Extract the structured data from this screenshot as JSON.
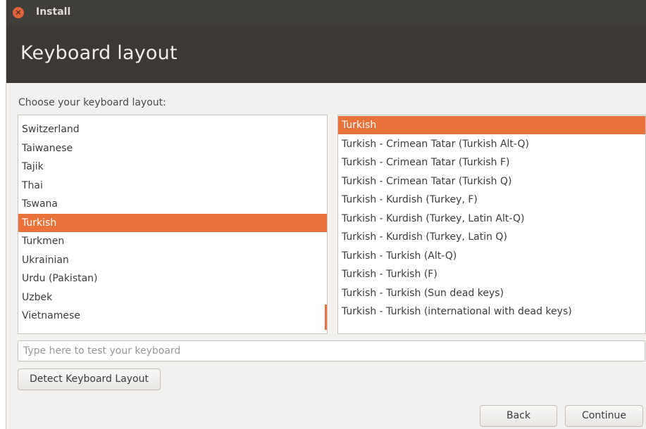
{
  "window": {
    "title": "Install"
  },
  "header": {
    "title": "Keyboard layout"
  },
  "prompt": "Choose your keyboard layout:",
  "layouts": {
    "items": [
      "Switzerland",
      "Taiwanese",
      "Tajik",
      "Thai",
      "Tswana",
      "Turkish",
      "Turkmen",
      "Ukrainian",
      "Urdu (Pakistan)",
      "Uzbek",
      "Vietnamese"
    ],
    "selected": "Turkish"
  },
  "variants": {
    "items": [
      "Turkish",
      "Turkish - Crimean Tatar (Turkish Alt-Q)",
      "Turkish - Crimean Tatar (Turkish F)",
      "Turkish - Crimean Tatar (Turkish Q)",
      "Turkish - Kurdish (Turkey, F)",
      "Turkish - Kurdish (Turkey, Latin Alt-Q)",
      "Turkish - Kurdish (Turkey, Latin Q)",
      "Turkish - Turkish (Alt-Q)",
      "Turkish - Turkish (F)",
      "Turkish - Turkish (Sun dead keys)",
      "Turkish - Turkish (international with dead keys)"
    ],
    "selected": "Turkish"
  },
  "test_input": {
    "placeholder": "Type here to test your keyboard",
    "value": ""
  },
  "buttons": {
    "detect": "Detect Keyboard Layout",
    "back": "Back",
    "continue": "Continue"
  },
  "colors": {
    "accent": "#e9713a",
    "header_bg": "#3b3835",
    "titlebar_bg": "#403e3a"
  }
}
